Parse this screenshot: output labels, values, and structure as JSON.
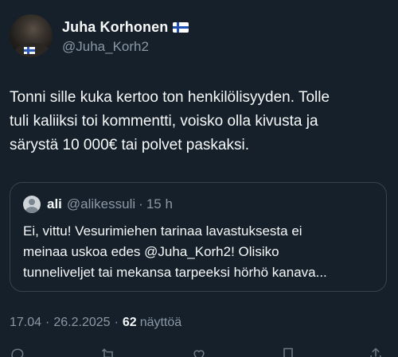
{
  "author": {
    "display_name": "Juha Korhonen",
    "flag_icon": "finland-flag-icon",
    "handle": "@Juha_Korh2"
  },
  "tweet": {
    "text": "Tonni sille kuka kertoo ton henkilölisyyden. Tolle\ntuli kaliiksi toi kommentti, voisko olla kivusta ja\nsärystä 10 000€ tai polvet paskaksi."
  },
  "quote": {
    "display_name": "ali",
    "handle": "@alikessuli",
    "separator": "·",
    "time": "15 h",
    "text": "Ei, vittu! Vesurimiehen tarinaa lavastuksesta ei\nmeinaa uskoa edes @Juha_Korh2! Olisiko\ntunneliveljet tai mekansa tarpeeksi hörhö kanava..."
  },
  "meta": {
    "time": "17.04",
    "separator": "·",
    "date": "26.2.2025",
    "views_count": "62",
    "views_label": "näyttöä"
  },
  "actions": [
    "reply-icon",
    "retweet-icon",
    "like-icon",
    "bookmark-icon",
    "share-icon"
  ],
  "colors": {
    "background": "#15202b",
    "text": "#f7f9f9",
    "secondary_text": "#8b98a5",
    "border": "#38444d"
  }
}
